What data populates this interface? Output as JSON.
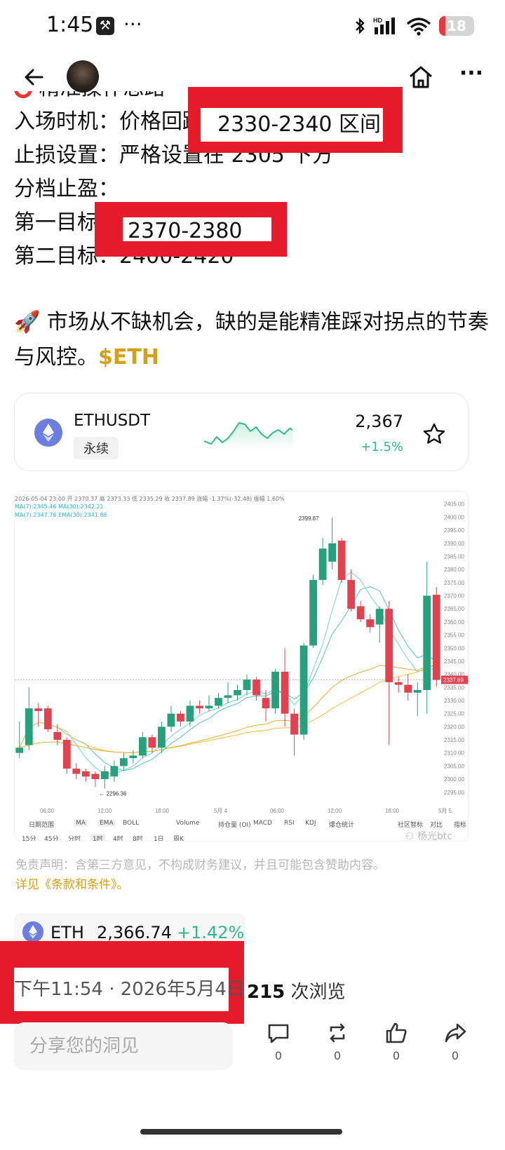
{
  "status_bar": {
    "time": "1:45",
    "dots": "···",
    "battery": "18",
    "battery_level": 0.18,
    "network": "HD"
  },
  "header": {
    "back_icon": "arrow-left-icon",
    "home_icon": "home-icon",
    "more_icon": "more-icon"
  },
  "post": {
    "cutoff_line": "精准操作思路",
    "lines": [
      "入场时机：价格回踩2330-2340 区间",
      "止损设置：严格设置在 2305 下方",
      "分档止盈：",
      "第一目标：2370-2380",
      "第二目标：2400-2420"
    ],
    "para2_emoji": "🚀",
    "para2_text": " 市场从不缺机会，缺的是能精准踩对拐点的节奏与风控。",
    "ticker_tag": "$ETH"
  },
  "ticker_card": {
    "symbol": "ETHUSDT",
    "tag": "永续",
    "price": "2,367",
    "change": "+1.5%",
    "favorite_icon": "star-icon"
  },
  "chart_data": {
    "type": "candlestick",
    "info": "2026-05-04 23:00  开 2370.37  高 2373.33  低 2335.29  收 2337.89  涨幅 -1.37%(-32.48)  振幅 1.60%",
    "ma_line1": "MA(7):2345.46  MA(30):2342.21",
    "ma_line2": "MA(7):2347.76  EMA(30):2341.86",
    "y_ticks": [
      "2405.00",
      "2400.00",
      "2395.00",
      "2390.00",
      "2385.00",
      "2380.00",
      "2375.00",
      "2370.00",
      "2365.00",
      "2360.00",
      "2355.00",
      "2350.00",
      "2345.00",
      "2340.00",
      "2335.00",
      "2330.00",
      "2325.00",
      "2320.00",
      "2315.00",
      "2310.00",
      "2305.00",
      "2300.00",
      "2295.00"
    ],
    "ylim": [
      2292,
      2406
    ],
    "x_ticks": [
      "06:00",
      "12:00",
      "18:00",
      "5月 4",
      "06:00",
      "12:00",
      "18:00",
      "5月 5"
    ],
    "last_price_label": "2337.89",
    "high_label": "2399.87",
    "low_label": "← 2296.36",
    "up_color": "#26a17b",
    "down_color": "#e0434f",
    "candles": [
      {
        "o": 2310,
        "h": 2322,
        "l": 2308,
        "c": 2312
      },
      {
        "o": 2313,
        "h": 2335,
        "l": 2311,
        "c": 2327
      },
      {
        "o": 2327,
        "h": 2329,
        "l": 2320,
        "c": 2326
      },
      {
        "o": 2327,
        "h": 2328,
        "l": 2318,
        "c": 2319
      },
      {
        "o": 2318,
        "h": 2321,
        "l": 2313,
        "c": 2315
      },
      {
        "o": 2315,
        "h": 2316,
        "l": 2302,
        "c": 2304
      },
      {
        "o": 2304,
        "h": 2306,
        "l": 2300,
        "c": 2302
      },
      {
        "o": 2303,
        "h": 2304,
        "l": 2299,
        "c": 2301
      },
      {
        "o": 2302,
        "h": 2303,
        "l": 2297,
        "c": 2300
      },
      {
        "o": 2300,
        "h": 2305,
        "l": 2296.36,
        "c": 2303
      },
      {
        "o": 2301,
        "h": 2307,
        "l": 2299,
        "c": 2305
      },
      {
        "o": 2305,
        "h": 2310,
        "l": 2303,
        "c": 2308
      },
      {
        "o": 2308,
        "h": 2311,
        "l": 2306,
        "c": 2309
      },
      {
        "o": 2309,
        "h": 2318,
        "l": 2308,
        "c": 2316
      },
      {
        "o": 2316,
        "h": 2317,
        "l": 2310,
        "c": 2312
      },
      {
        "o": 2312,
        "h": 2322,
        "l": 2310,
        "c": 2320
      },
      {
        "o": 2320,
        "h": 2328,
        "l": 2318,
        "c": 2325
      },
      {
        "o": 2325,
        "h": 2326,
        "l": 2320,
        "c": 2322
      },
      {
        "o": 2322,
        "h": 2330,
        "l": 2320,
        "c": 2328
      },
      {
        "o": 2328,
        "h": 2330,
        "l": 2325,
        "c": 2327
      },
      {
        "o": 2327,
        "h": 2332,
        "l": 2326,
        "c": 2328
      },
      {
        "o": 2328,
        "h": 2333,
        "l": 2327,
        "c": 2331
      },
      {
        "o": 2331,
        "h": 2337,
        "l": 2329,
        "c": 2332
      },
      {
        "o": 2332,
        "h": 2336,
        "l": 2330,
        "c": 2334
      },
      {
        "o": 2334,
        "h": 2340,
        "l": 2332,
        "c": 2338
      },
      {
        "o": 2338,
        "h": 2339,
        "l": 2330,
        "c": 2332
      },
      {
        "o": 2331,
        "h": 2334,
        "l": 2322,
        "c": 2327
      },
      {
        "o": 2327,
        "h": 2342,
        "l": 2325,
        "c": 2341
      },
      {
        "o": 2341,
        "h": 2350,
        "l": 2320,
        "c": 2325
      },
      {
        "o": 2325,
        "h": 2327,
        "l": 2309,
        "c": 2317
      },
      {
        "o": 2317,
        "h": 2352,
        "l": 2315,
        "c": 2351
      },
      {
        "o": 2351,
        "h": 2378,
        "l": 2350,
        "c": 2376
      },
      {
        "o": 2376,
        "h": 2392,
        "l": 2374,
        "c": 2388
      },
      {
        "o": 2383,
        "h": 2399.87,
        "l": 2380,
        "c": 2390
      },
      {
        "o": 2391,
        "h": 2392,
        "l": 2375,
        "c": 2376
      },
      {
        "o": 2376,
        "h": 2380,
        "l": 2364,
        "c": 2365
      },
      {
        "o": 2366,
        "h": 2368,
        "l": 2360,
        "c": 2361
      },
      {
        "o": 2361,
        "h": 2363,
        "l": 2356,
        "c": 2358
      },
      {
        "o": 2359,
        "h": 2366,
        "l": 2352,
        "c": 2365
      },
      {
        "o": 2365,
        "h": 2368,
        "l": 2313,
        "c": 2337
      },
      {
        "o": 2337,
        "h": 2339,
        "l": 2333,
        "c": 2336
      },
      {
        "o": 2336,
        "h": 2340,
        "l": 2330,
        "c": 2333
      },
      {
        "o": 2333,
        "h": 2337,
        "l": 2324,
        "c": 2334
      },
      {
        "o": 2334,
        "h": 2383,
        "l": 2325,
        "c": 2370
      },
      {
        "o": 2370.37,
        "h": 2373.33,
        "l": 2335.29,
        "c": 2337.89
      }
    ],
    "toolbar1": [
      "日期范围",
      "MA",
      "EMA",
      "BOLL",
      "Volume",
      "持仓量 (OI)",
      "MACD",
      "RSI",
      "KDJ",
      "爆仓统计",
      "社区智标",
      "对比",
      "指标"
    ],
    "toolbar2": [
      "15分",
      "45分",
      "分时",
      "1时",
      "4时",
      "8时",
      "1日",
      "周K"
    ],
    "active_interval": "1时"
  },
  "disclaimer": {
    "text": "免责声明：含第三方意见，不构成财务建议，并且可能包含赞助内容。",
    "link": "详见《条款和条件》。"
  },
  "watermark": "⚇ 杨光btc",
  "eth_row": {
    "symbol": "ETH",
    "price": "2,366.74",
    "change": "+1.42%"
  },
  "meta": {
    "time_date": "下午11:54 · 2026年5月4日",
    "views_count": "215",
    "views_label": " 次浏览"
  },
  "footer": {
    "share_placeholder": "分享您的洞见",
    "comment_count": "0",
    "repost_count": "0",
    "like_count": "0",
    "share_count": "0"
  }
}
